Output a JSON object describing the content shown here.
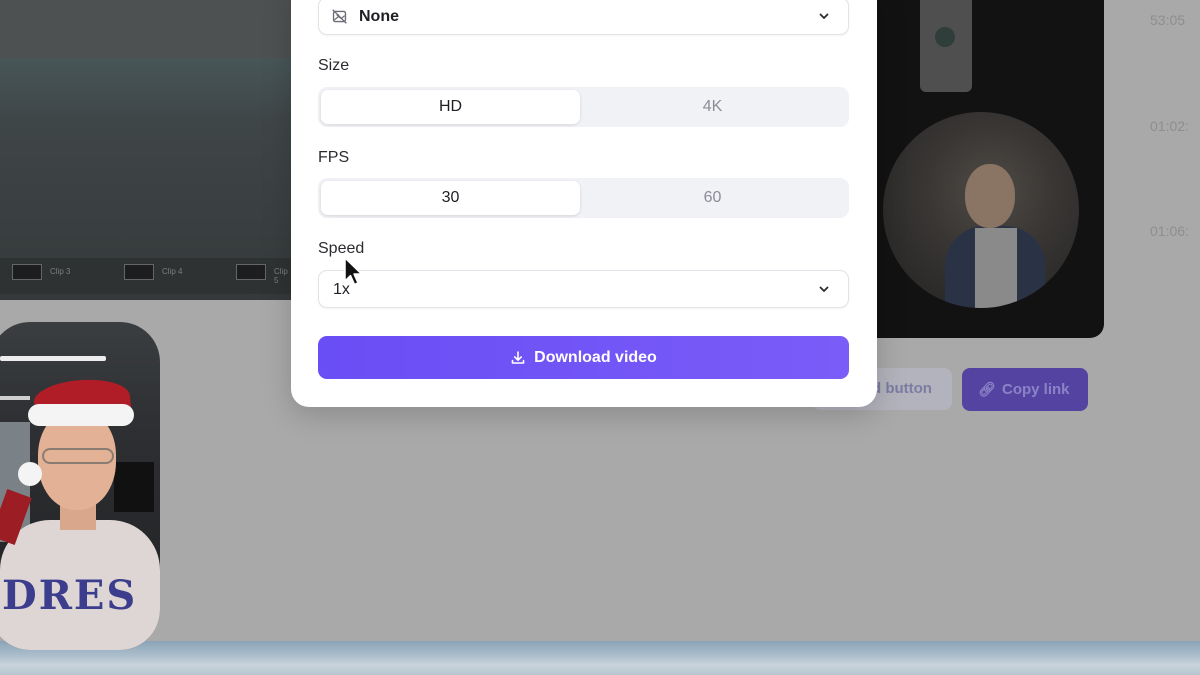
{
  "background": {
    "times": [
      "53:05",
      "01:02:",
      "01:06:"
    ],
    "clip_labels": [
      "Clip 3",
      "Clip 4",
      "Clip 5"
    ],
    "embed_button_label": "d button",
    "copy_link_label": "Copy link"
  },
  "webcam": {
    "shirt_text": "DRES"
  },
  "modal": {
    "background_select": {
      "value": "None",
      "icon": "no-background-icon"
    },
    "size": {
      "label": "Size",
      "options": [
        "HD",
        "4K"
      ],
      "selected": "HD"
    },
    "fps": {
      "label": "FPS",
      "options": [
        "30",
        "60"
      ],
      "selected": "30"
    },
    "speed": {
      "label": "Speed",
      "value": "1x"
    },
    "download_label": "Download video"
  },
  "colors": {
    "accent": "#6a4ef5",
    "text": "#1f1f24",
    "muted": "#8c8d96"
  }
}
